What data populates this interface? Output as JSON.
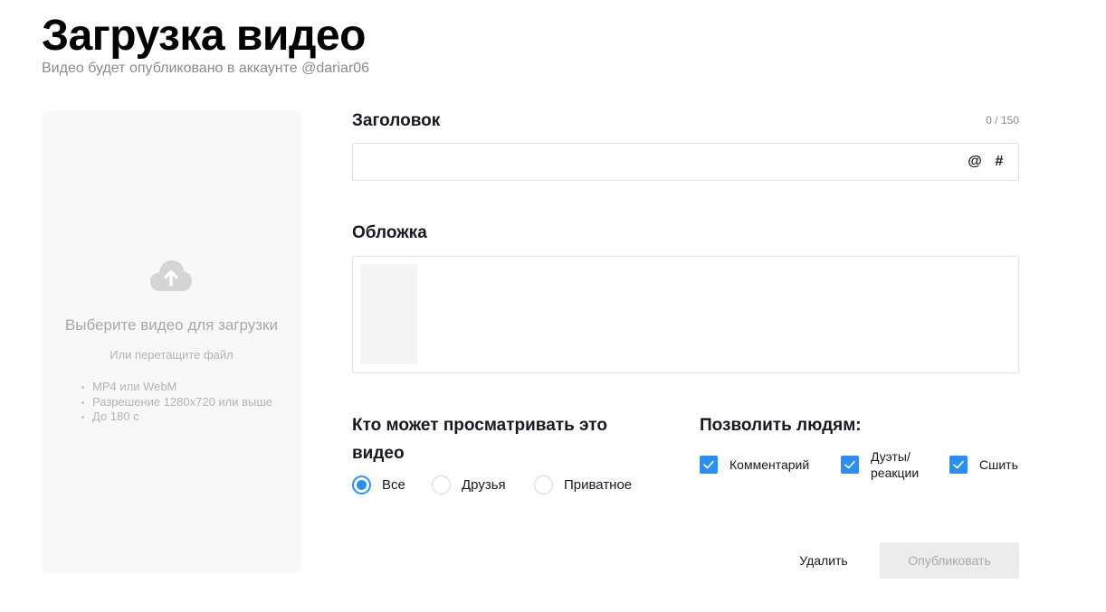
{
  "header": {
    "title": "Загрузка видео",
    "subtitle": "Видео будет опубликовано в аккаунте @dariar06"
  },
  "upload": {
    "icon": "cloud-upload-icon",
    "title": "Выберите видео для загрузки",
    "subtitle": "Или перетащите файл",
    "requirements": [
      "MP4 или WebM",
      "Разрешение 1280x720 или выше",
      "До 180 с"
    ]
  },
  "caption": {
    "label": "Заголовок",
    "counter": "0 / 150",
    "value": "",
    "mention_symbol": "@",
    "hashtag_symbol": "#"
  },
  "cover": {
    "label": "Обложка"
  },
  "privacy": {
    "title": "Кто может просматривать это видео",
    "options": [
      {
        "label": "Все",
        "selected": true
      },
      {
        "label": "Друзья",
        "selected": false
      },
      {
        "label": "Приватное",
        "selected": false
      }
    ]
  },
  "allow": {
    "title": "Позволить людям:",
    "options": [
      {
        "label": "Комментарий",
        "checked": true
      },
      {
        "label": "Дуэты/ реакции",
        "checked": true
      },
      {
        "label": "Сшить",
        "checked": true
      }
    ]
  },
  "actions": {
    "delete_label": "Удалить",
    "publish_label": "Опубликовать"
  },
  "colors": {
    "accent": "#2e8ef0",
    "panel_bg": "#f8f8f8",
    "disabled_button_bg": "#ececed"
  }
}
